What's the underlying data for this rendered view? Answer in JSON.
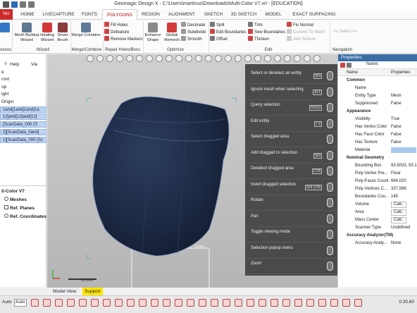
{
  "window": {
    "title": "Geomagic Design X - C:\\Users\\martinus\\Downloads\\Multi-Color V7.xrl - [EDUCATION]"
  },
  "app_menu": {
    "label": "NU"
  },
  "tabs": [
    {
      "label": "HOME"
    },
    {
      "label": "LIVECAPTURE"
    },
    {
      "label": "FONTS"
    },
    {
      "label": "POLYGONS"
    },
    {
      "label": "REGION"
    },
    {
      "label": "ALIGNMENT"
    },
    {
      "label": "SKETCH"
    },
    {
      "label": "3D SKETCH"
    },
    {
      "label": "MODEL"
    },
    {
      "label": "EXACT SURFACING"
    }
  ],
  "ribbon": {
    "scan_label": "can\nes",
    "mesh_buildup": "Mesh Buildup\nWizard",
    "healing": "Healing\nWizard",
    "smart_brush": "Smart\nBrush",
    "merge_combine": "Merge Combine",
    "fill_holes": "Fill Holes",
    "defeature": "Defeature",
    "remove_markers": "Remove Markers",
    "enhance_shape": "Enhance\nShape",
    "global_remesh": "Global\nRemesh",
    "decimate": "Decimate",
    "subdivide": "Subdivide",
    "smooth": "Smooth",
    "split": "Split",
    "edit_boundaries": "Edit Boundaries",
    "offset": "Offset",
    "trim": "Trim",
    "sew_boundaries": "Sew Boundaries",
    "thicken": "Thicken",
    "fix_normal": "Fix Normal",
    "convert_to_mesh": "Convert To Mesh",
    "add_texture": "Add Texture",
    "select_placeholder": "<< Select >>",
    "groups": {
      "process": "ocess",
      "wizard": "Wizard",
      "merge_combine": "Merge/Combine",
      "repair": "Repair Holes/Boss",
      "optimize": "Optimize",
      "edit": "Edit",
      "navigation": "Navigation"
    }
  },
  "left_panel": {
    "help": "Help",
    "view": "Vie",
    "tree_items": [
      "e",
      "ront",
      "op",
      "ight",
      "Origin"
    ],
    "selected_items": [
      "1and[1and[1and[1a",
      "12]and[12]and[12]",
      "[ScanData_000 (S",
      "2][ScanData_0and[",
      "1][ScanData_000 (Sc"
    ],
    "model_title": "ti-Color V7",
    "model_items": [
      "Meshes",
      "Ref. Planes",
      "Ref. Coordinates"
    ]
  },
  "mouse_help": {
    "items": [
      {
        "label": "Select or deselect an entity",
        "key": "SHI"
      },
      {
        "label": "Ignore mesh when selecting",
        "key": "ALT"
      },
      {
        "label": "Query selection",
        "key": "HOLD"
      },
      {
        "label": "Edit entity",
        "key": "× 2"
      },
      {
        "label": "Select dragged area",
        "key": ""
      },
      {
        "label": "Add dragged to selection",
        "key": "SHI"
      },
      {
        "label": "Deselect dragged area",
        "key": "CTR"
      },
      {
        "label": "Invert dragged selection",
        "key": "SHI CTR"
      },
      {
        "label": "Rotate",
        "key": ""
      },
      {
        "label": "Pan",
        "key": ""
      },
      {
        "label": "Toggle viewing mode",
        "key": ""
      },
      {
        "label": "Selection popup menu",
        "key": ""
      },
      {
        "label": "Zoom",
        "key": ""
      }
    ]
  },
  "properties": {
    "title": "Properties",
    "name_label": "Name:",
    "col_name": "Name",
    "col_props": "Properties",
    "rows": [
      {
        "type": "cat",
        "name": "Common"
      },
      {
        "type": "row",
        "name": "Name",
        "value": ""
      },
      {
        "type": "row",
        "name": "Entity Type",
        "value": "Mesh"
      },
      {
        "type": "row",
        "name": "Suppressed",
        "value": "False"
      },
      {
        "type": "cat",
        "name": "Appearance"
      },
      {
        "type": "row",
        "name": "Visibility",
        "value": "True"
      },
      {
        "type": "row",
        "name": "Has Vertex Color",
        "value": "False"
      },
      {
        "type": "row",
        "name": "Has Face Color",
        "value": "False"
      },
      {
        "type": "row",
        "name": "Has Texture",
        "value": "False"
      },
      {
        "type": "row",
        "name": "Material",
        "value": ""
      },
      {
        "type": "cat",
        "name": "Nominal Geometry"
      },
      {
        "type": "row",
        "name": "Bounding Box",
        "value": "93.5033, 93.1"
      },
      {
        "type": "row",
        "name": "Poly-Vertex Pre...",
        "value": "Float"
      },
      {
        "type": "row",
        "name": "Poly-Faces Count",
        "value": "664,020"
      },
      {
        "type": "row",
        "name": "Poly-Vertices C...",
        "value": "337,568"
      },
      {
        "type": "row",
        "name": "Boundaries Cou...",
        "value": "145"
      },
      {
        "type": "row",
        "name": "Volume",
        "value": "Calc."
      },
      {
        "type": "row",
        "name": "Area",
        "value": "Calc."
      },
      {
        "type": "row",
        "name": "Mass Center",
        "value": "Calc."
      },
      {
        "type": "row",
        "name": "Scanner Type",
        "value": "Undefined"
      },
      {
        "type": "cat",
        "name": "Accuracy Analyzer(TM)"
      },
      {
        "type": "row",
        "name": "Accuracy Analy...",
        "value": "None"
      }
    ]
  },
  "viewport": {
    "scale_label": "25 mm",
    "plane_label": "Front"
  },
  "bottom_tabs": {
    "model_view": "Model View",
    "support": "Support"
  },
  "status": {
    "mode": "Auto",
    "time": "0:30.60"
  },
  "colors": {
    "accent": "#cc2a2a",
    "selection": "#bcd3f2",
    "mesh": "#1d2a44",
    "overlay": "#464646"
  }
}
